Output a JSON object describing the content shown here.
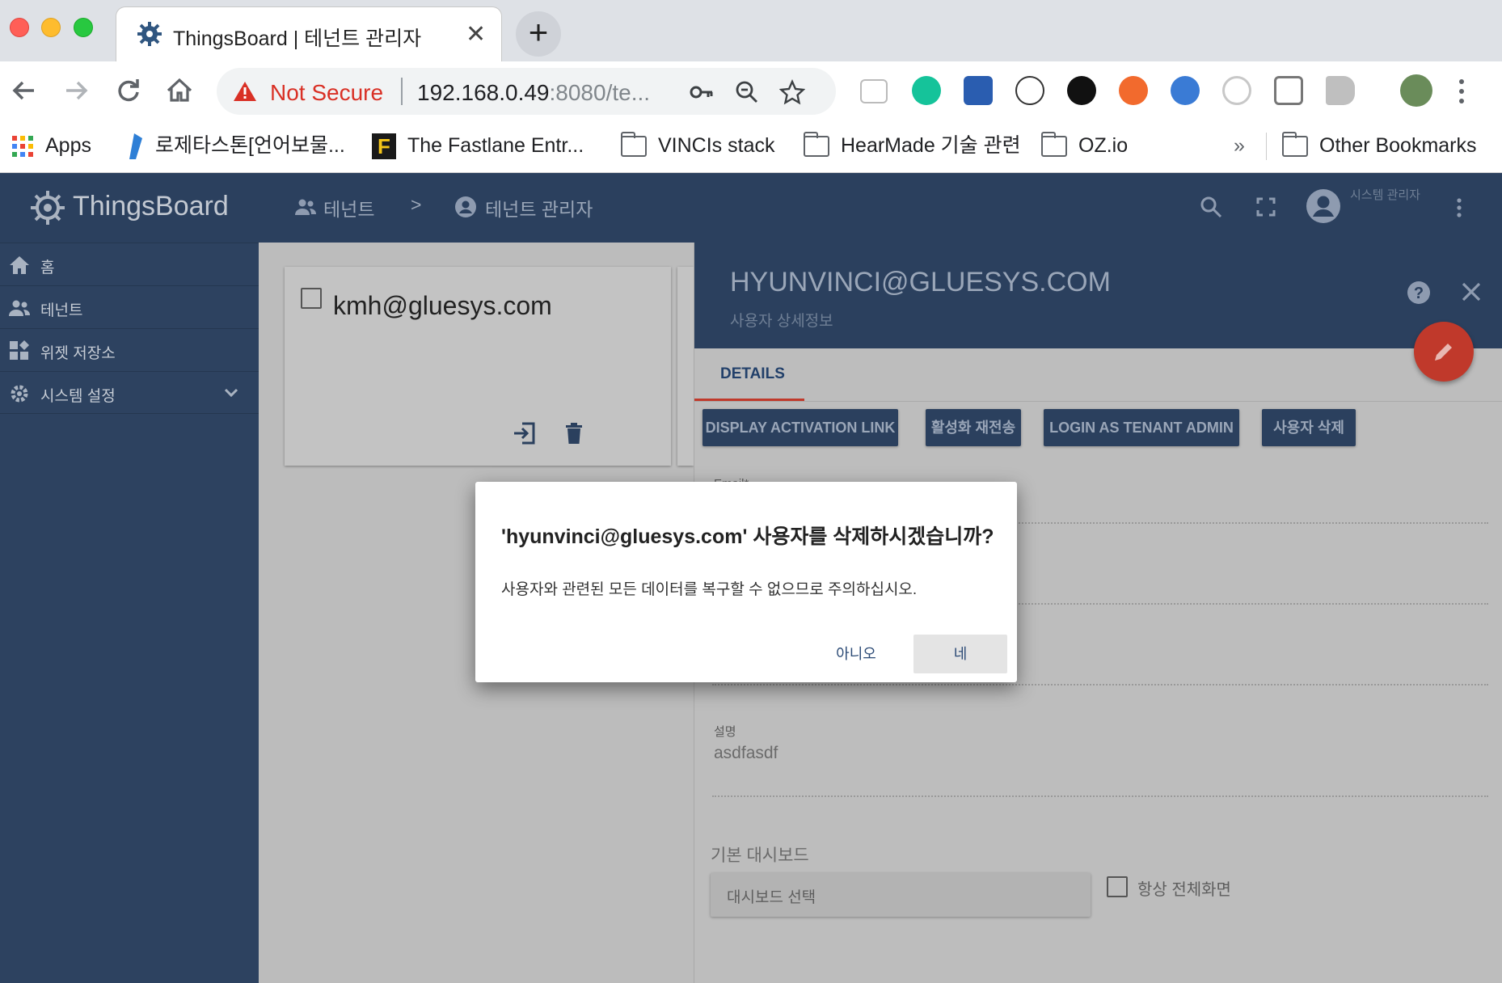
{
  "browser": {
    "tab_title": "ThingsBoard | 테넌트 관리자",
    "security_label": "Not Secure",
    "url_host": "192.168.0.49",
    "url_rest": ":8080/te...",
    "bookmarks": [
      {
        "label": "Apps",
        "icon": "apps-grid-icon"
      },
      {
        "label": "로제타스톤[언어보물...",
        "icon": "rosetta-icon"
      },
      {
        "label": "The Fastlane Entr...",
        "icon": "fastlane-icon"
      },
      {
        "label": "VINCIs stack",
        "icon": "folder-icon"
      },
      {
        "label": "HearMade 기술 관련",
        "icon": "folder-icon"
      },
      {
        "label": "OZ.io",
        "icon": "folder-icon"
      }
    ],
    "more_bookmarks": "»",
    "other_bookmarks": "Other Bookmarks"
  },
  "app": {
    "logo_text": "ThingsBoard",
    "menu": [
      {
        "label": "홈",
        "icon": "home-icon"
      },
      {
        "label": "테넌트",
        "icon": "people-icon"
      },
      {
        "label": "위젯 저장소",
        "icon": "widgets-icon"
      },
      {
        "label": "시스템 설정",
        "icon": "gear-icon"
      }
    ],
    "breadcrumb": {
      "first": "테넌트",
      "separator": ">",
      "second": "테넌트 관리자"
    },
    "user_role": "시스템 관리자"
  },
  "list": {
    "card_title": "kmh@gluesys.com"
  },
  "details": {
    "title": "HYUNVINCI@GLUESYS.COM",
    "subtitle": "사용자 상세정보",
    "tab": "DETAILS",
    "buttons": {
      "display_activation": "DISPLAY ACTIVATION LINK",
      "resend": "활성화 재전송",
      "login_as": "LOGIN AS TENANT ADMIN",
      "delete_user": "사용자 삭제"
    },
    "email_label": "Email*",
    "description_label": "설명",
    "description_value": "asdfasdf",
    "default_dashboard_label": "기본 대시보드",
    "dashboard_placeholder": "대시보드 선택",
    "always_fullscreen": "항상 전체화면"
  },
  "dialog": {
    "title": "'hyunvinci@gluesys.com' 사용자를 삭제하시겠습니까?",
    "body": "사용자와 관련된 모든 데이터를 복구할 수 없으므로 주의하십시오.",
    "no": "아니오",
    "yes": "네"
  },
  "colors": {
    "primary": "#2b405e",
    "accent": "#c0392b",
    "not_secure": "#d93025"
  }
}
